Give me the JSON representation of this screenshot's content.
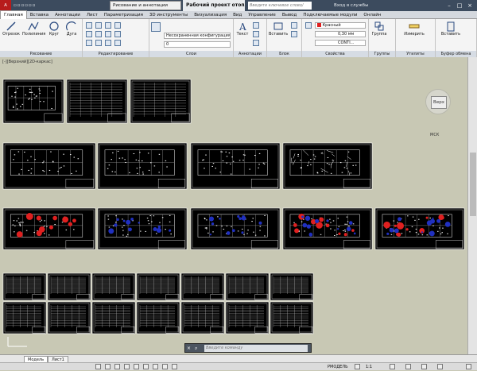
{
  "app": {
    "workspace": "Рисование и аннотации",
    "document_title": "Рабочий проект отоплени...",
    "search_placeholder": "Введите ключевое слово/фразу",
    "signin": "Вход в службы"
  },
  "menu_tabs": [
    "Главная",
    "Вставка",
    "Аннотации",
    "Лист",
    "Параметризация",
    "3D инструменты",
    "Визуализация",
    "Вид",
    "Управление",
    "Вывод",
    "Подключаемые модули",
    "Онлайн"
  ],
  "ribbon": {
    "draw": {
      "label": "Рисование",
      "line": "Отрезок",
      "polyline": "Полилиния",
      "circle": "Круг",
      "arc": "Дуга"
    },
    "modify": {
      "label": "Редактирование"
    },
    "layers": {
      "label": "Слои",
      "state": "Несохраненная конфигурация сло",
      "layer": "0"
    },
    "annotation": {
      "label": "Аннотации",
      "text": "Текст"
    },
    "block": {
      "label": "Блок",
      "insert": "Вставить"
    },
    "properties": {
      "label": "Свойства",
      "color": "Красный",
      "lineweight": "0,30 мм",
      "linetype": "CONTI..."
    },
    "groups": {
      "label": "Группы",
      "group": "Группа"
    },
    "utilities": {
      "label": "Утилиты",
      "measure": "Измерить"
    },
    "clipboard": {
      "label": "Буфер обмена",
      "paste": "Вставить"
    }
  },
  "viewport": {
    "label": "[-][Верхний][2D-каркас]",
    "viewcube": "Верх",
    "wcs": "МСК"
  },
  "command": {
    "placeholder": "Введите команду"
  },
  "layout_tabs": [
    "Модель",
    "Лист1"
  ],
  "status": {
    "model": "РМОДЕЛЬ",
    "scale": "1:1"
  },
  "colors": {
    "titlebar": "#3c4b5e",
    "viewport_bg": "#c8c8b4",
    "red": "#e02020",
    "blue": "#2030c0"
  }
}
